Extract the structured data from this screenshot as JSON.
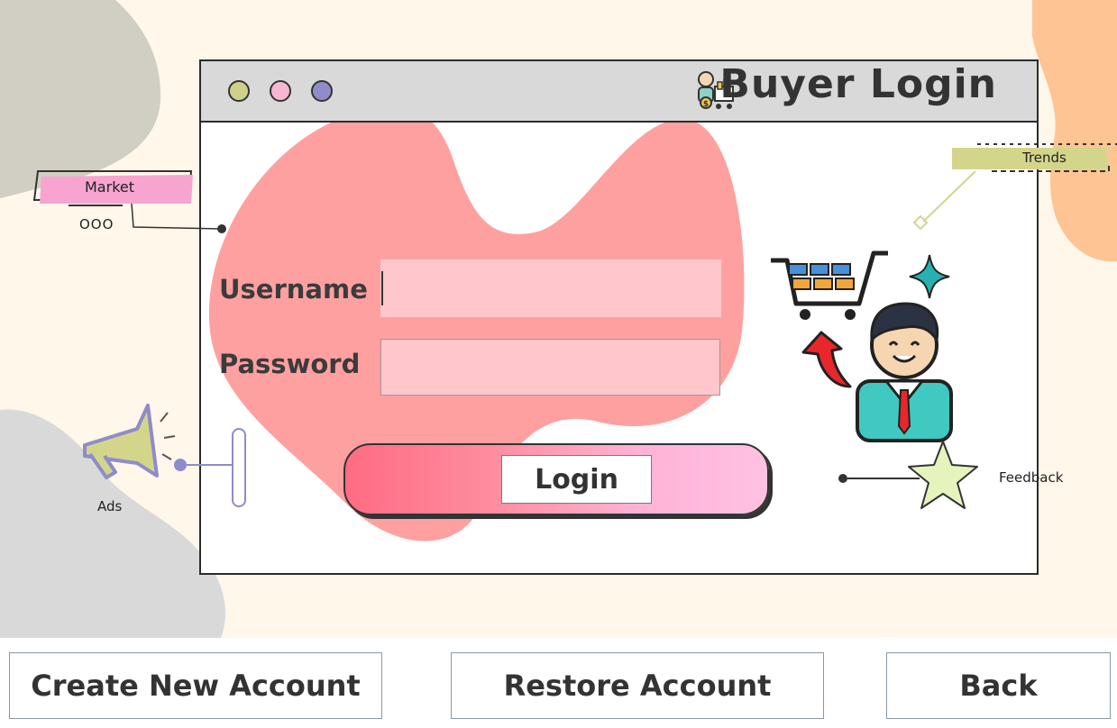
{
  "window": {
    "title": "Buyer Login"
  },
  "form": {
    "username_label": "Username",
    "username_value": "",
    "password_label": "Password",
    "password_value": "",
    "login_label": "Login"
  },
  "decor": {
    "market_tag": "Market",
    "market_dots": "OOO",
    "trends_tag": "Trends",
    "ads_label": "Ads",
    "feedback_label": "Feedback"
  },
  "footer": {
    "create_account_label": "Create New Account",
    "restore_account_label": "Restore Account",
    "back_label": "Back"
  },
  "colors": {
    "background": "#fff7ea",
    "titlebar": "#d9d9d9",
    "field": "#ffc7cb",
    "blob_red": "#ff8f8f",
    "accent_pink": "#ffb3d6"
  }
}
